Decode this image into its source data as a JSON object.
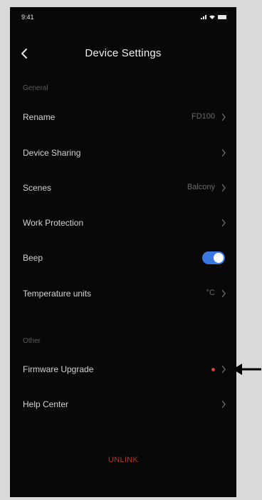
{
  "status_bar": {
    "time": "9:41"
  },
  "header": {
    "title": "Device Settings",
    "back_icon": "chevron-left-icon"
  },
  "sections": {
    "general": "General",
    "other": "Other"
  },
  "rows": {
    "rename": {
      "label": "Rename",
      "value": "FD100"
    },
    "device_sharing": {
      "label": "Device Sharing"
    },
    "scenes": {
      "label": "Scenes",
      "value": "Balcony"
    },
    "work_protection": {
      "label": "Work Protection"
    },
    "beep": {
      "label": "Beep",
      "enabled": true
    },
    "temperature_units": {
      "label": "Temperature units",
      "value": "°C"
    },
    "firmware_upgrade": {
      "label": "Firmware Upgrade",
      "has_update_dot": true
    },
    "help_center": {
      "label": "Help Center"
    }
  },
  "unlink": {
    "label": "UNLINK"
  },
  "colors": {
    "background": "#080808",
    "toggle_on": "#3a78e0",
    "update_dot": "#d8422e",
    "unlink_text": "#b33628",
    "outer_background": "#d9d9d9"
  },
  "annotation": {
    "icon": "arrow-left-icon"
  }
}
